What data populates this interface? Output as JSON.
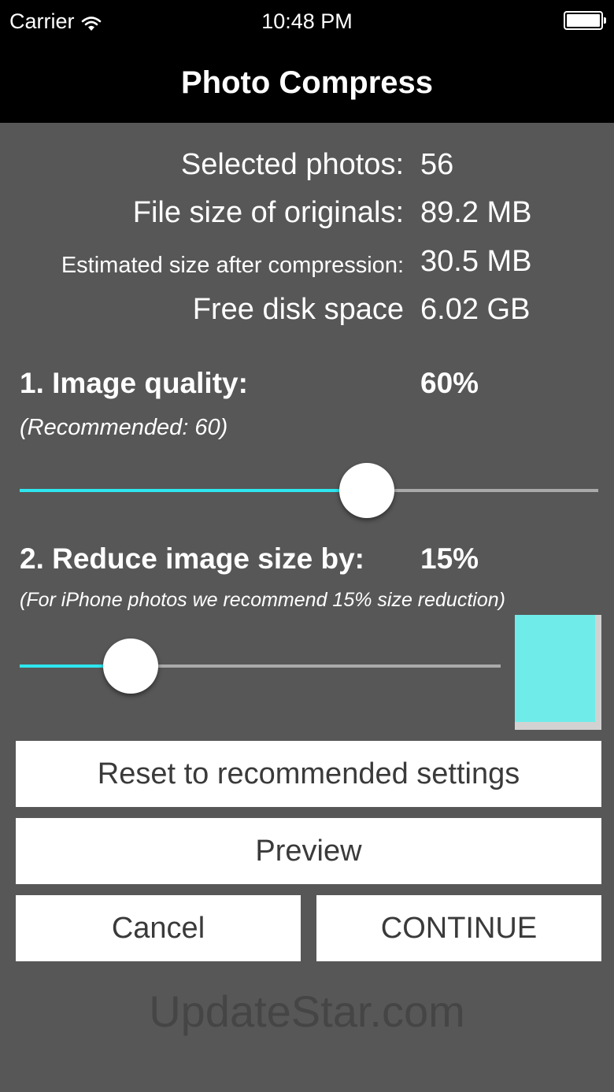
{
  "status_bar": {
    "carrier": "Carrier",
    "time": "10:48 PM",
    "wifi_icon": "wifi-icon",
    "battery_icon": "battery-icon"
  },
  "nav": {
    "title": "Photo Compress"
  },
  "info": {
    "selected_photos": {
      "label": "Selected photos:",
      "value": "56"
    },
    "file_size": {
      "label": "File size of originals:",
      "value": "89.2 MB"
    },
    "estimated_size": {
      "label": "Estimated size after compression:",
      "value": "30.5 MB"
    },
    "free_disk": {
      "label": "Free disk space",
      "value": "6.02 GB"
    }
  },
  "quality": {
    "heading": "1. Image quality:",
    "value_text": "60%",
    "note": "(Recommended: 60)",
    "slider_value": 0.6
  },
  "resize": {
    "heading": "2. Reduce image size by:",
    "value_text": "15%",
    "note": "(For iPhone photos we recommend 15% size reduction)",
    "slider_value": 0.23
  },
  "colors": {
    "accent": "#2ee6ee",
    "swatch": "#6fecea",
    "background": "#575757",
    "bar": "#000000"
  },
  "buttons": {
    "reset": "Reset to recommended settings",
    "preview": "Preview",
    "cancel": "Cancel",
    "continue": "CONTINUE"
  },
  "watermark": "UpdateStar.com"
}
